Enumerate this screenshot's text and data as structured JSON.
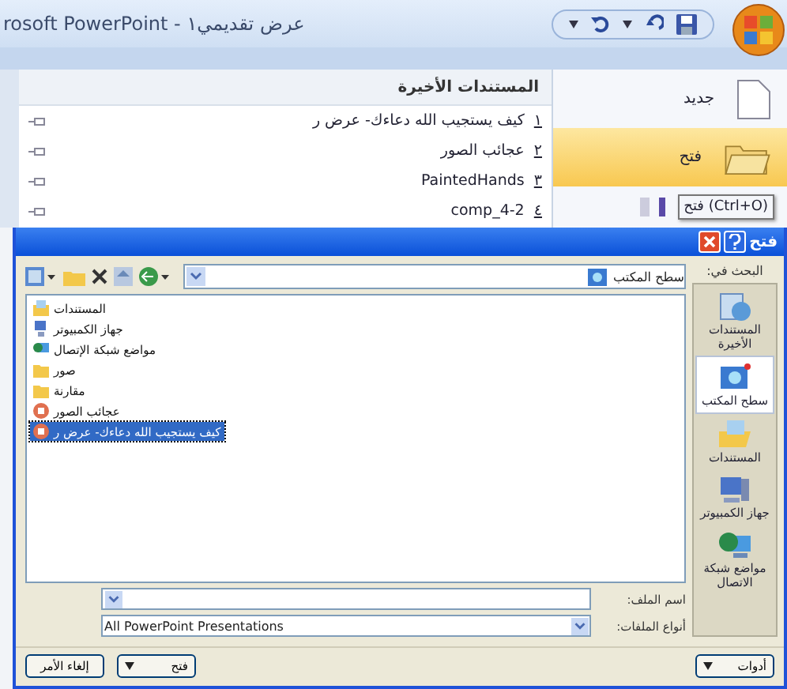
{
  "window": {
    "title": "rosoft PowerPoint - عرض تقديمي١"
  },
  "office_menu": {
    "recent_heading": "المستندات الأخيرة",
    "recent": [
      {
        "number": "١",
        "name": "كيف يستجيب الله دعاءك- عرض ر"
      },
      {
        "number": "٢",
        "name": "عجائب الصور"
      },
      {
        "number": "٣",
        "name": "PaintedHands"
      },
      {
        "number": "٤",
        "name": "comp_4-2"
      }
    ],
    "commands": [
      {
        "label": "جديد",
        "kind": "new",
        "selected": false
      },
      {
        "label": "فتح",
        "kind": "open",
        "selected": true
      }
    ],
    "tooltip": "فتح (Ctrl+O)"
  },
  "dialog": {
    "title": "فتح",
    "look_in_label": "البحث في:",
    "look_in": "سطح المكتب",
    "files": [
      {
        "name": "المستندات",
        "kind": "docs",
        "selected": false
      },
      {
        "name": "جهاز الكمبيوتر",
        "kind": "computer",
        "selected": false
      },
      {
        "name": "مواضع شبكة الإتصال",
        "kind": "network",
        "selected": false
      },
      {
        "name": "صور",
        "kind": "folder",
        "selected": false
      },
      {
        "name": "مقارنة",
        "kind": "folder",
        "selected": false
      },
      {
        "name": "عجائب الصور",
        "kind": "ppt",
        "selected": false
      },
      {
        "name": "كيف يستجيب الله دعاءك- عرض ر",
        "kind": "ppt",
        "selected": true
      }
    ],
    "places": [
      {
        "label": "المستندات الأخيرة",
        "kind": "recent",
        "selected": false
      },
      {
        "label": "سطح المكتب",
        "kind": "desktop",
        "selected": true
      },
      {
        "label": "المستندات",
        "kind": "docs",
        "selected": false
      },
      {
        "label": "جهاز الكمبيوتر",
        "kind": "computer",
        "selected": false
      },
      {
        "label": "مواضع شبكة الاتصال",
        "kind": "network",
        "selected": false
      }
    ],
    "file_name_label": "اسم الملف:",
    "file_types_label": "أنواع الملفات:",
    "file_type": "All PowerPoint Presentations",
    "buttons": {
      "tools": "أدوات",
      "open": "فتح",
      "cancel": "إلغاء الأمر"
    }
  }
}
